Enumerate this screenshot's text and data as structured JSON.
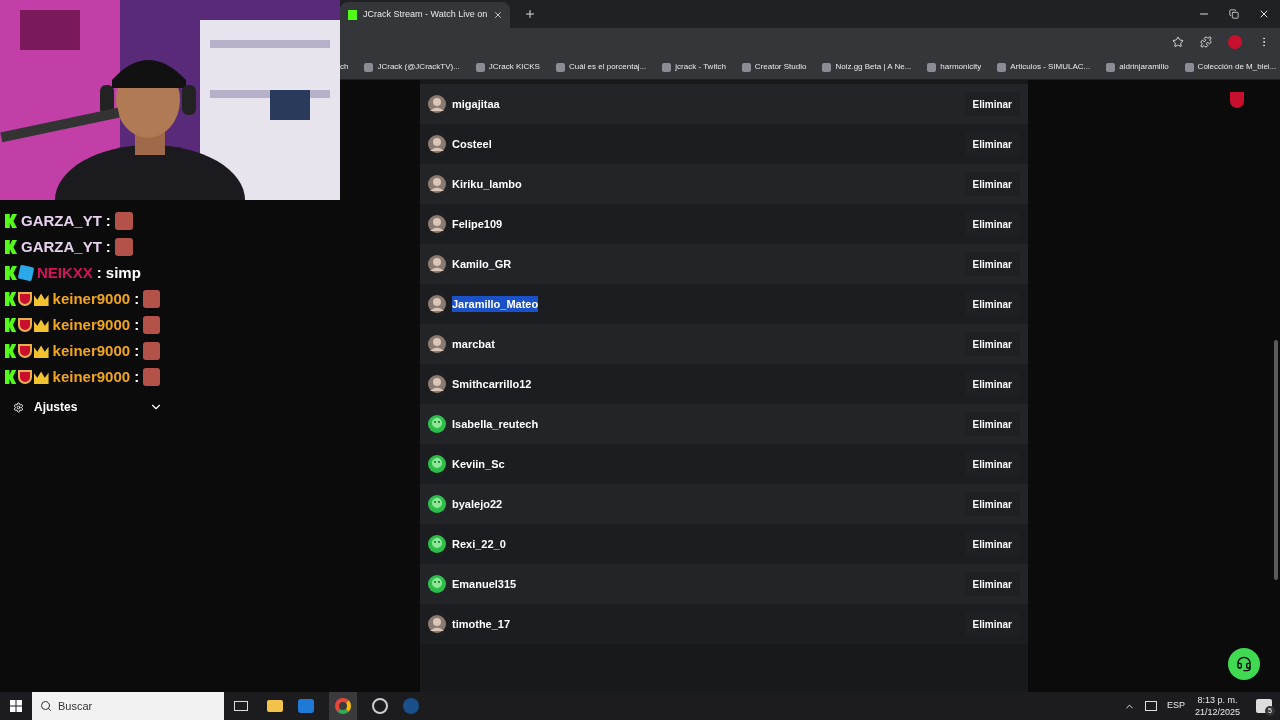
{
  "browser": {
    "tab": {
      "title": "JCrack Stream - Watch Live on",
      "selected": true
    },
    "bookmarks": [
      "ch",
      "JCrack (@JCrackTV)...",
      "JCrack KICKS",
      "Cuál es el porcentaj...",
      "jcrack - Twitch",
      "Creator Studio",
      "Noiz.gg Beta | A Ne...",
      "harmonicity",
      "Articulos - SIMULAC...",
      "aldrinjaramillo",
      "Colección de M_blei..."
    ]
  },
  "chat": [
    {
      "user": "GARZA_YT",
      "color": "#e6d2ee",
      "badges": [
        {
          "kind": "kick"
        }
      ],
      "separator": ":",
      "kind": "emote"
    },
    {
      "user": "GARZA_YT",
      "color": "#e6d2ee",
      "badges": [
        {
          "kind": "kick"
        }
      ],
      "separator": ":",
      "kind": "emote"
    },
    {
      "user": "NEIKXX",
      "color": "#d4145a",
      "badges": [
        {
          "kind": "kick"
        },
        {
          "kind": "cube"
        }
      ],
      "separator": ":",
      "kind": "text",
      "text": "simp"
    },
    {
      "user": "keiner9000",
      "color": "#f2a51e",
      "badges": [
        {
          "kind": "kick"
        },
        {
          "kind": "shield"
        },
        {
          "kind": "crown"
        }
      ],
      "separator": ":",
      "kind": "emote"
    },
    {
      "user": "keiner9000",
      "color": "#f2a51e",
      "badges": [
        {
          "kind": "kick"
        },
        {
          "kind": "shield"
        },
        {
          "kind": "crown"
        }
      ],
      "separator": ":",
      "kind": "emote"
    },
    {
      "user": "keiner9000",
      "color": "#f2a51e",
      "badges": [
        {
          "kind": "kick"
        },
        {
          "kind": "shield"
        },
        {
          "kind": "crown"
        }
      ],
      "separator": ":",
      "kind": "emote"
    },
    {
      "user": "keiner9000",
      "color": "#f2a51e",
      "badges": [
        {
          "kind": "kick"
        },
        {
          "kind": "shield"
        },
        {
          "kind": "crown"
        }
      ],
      "separator": ":",
      "kind": "emote"
    }
  ],
  "sidebar": {
    "settings": {
      "label": "Ajustes",
      "expanded": false
    }
  },
  "users": [
    {
      "name": "migajitaa",
      "highlighted": false,
      "action": "Eliminar"
    },
    {
      "name": "Costeel",
      "highlighted": false,
      "action": "Eliminar"
    },
    {
      "name": "Kiriku_lambo",
      "highlighted": false,
      "action": "Eliminar"
    },
    {
      "name": "Felipe109",
      "highlighted": false,
      "action": "Eliminar"
    },
    {
      "name": "Kamilo_GR",
      "highlighted": false,
      "action": "Eliminar"
    },
    {
      "name": "Jaramillo_Mateo",
      "highlighted": true,
      "action": "Eliminar"
    },
    {
      "name": "marcbat",
      "highlighted": false,
      "action": "Eliminar"
    },
    {
      "name": "Smithcarrillo12",
      "highlighted": false,
      "action": "Eliminar"
    },
    {
      "name": "Isabella_reutech",
      "kind": "default",
      "highlighted": false,
      "action": "Eliminar"
    },
    {
      "name": "Keviin_Sc",
      "kind": "default",
      "highlighted": false,
      "action": "Eliminar"
    },
    {
      "name": "byalejo22",
      "kind": "default",
      "highlighted": false,
      "action": "Eliminar"
    },
    {
      "name": "Rexi_22_0",
      "kind": "default",
      "highlighted": false,
      "action": "Eliminar"
    },
    {
      "name": "Emanuel315",
      "kind": "default",
      "highlighted": false,
      "action": "Eliminar"
    },
    {
      "name": "timothe_17",
      "highlighted": false,
      "action": "Eliminar"
    }
  ],
  "taskbar": {
    "search": {
      "placeholder": "Buscar"
    },
    "language": "ESP",
    "time": "8:13 p. m.",
    "date": "21/12/2025",
    "notifications": "5"
  }
}
